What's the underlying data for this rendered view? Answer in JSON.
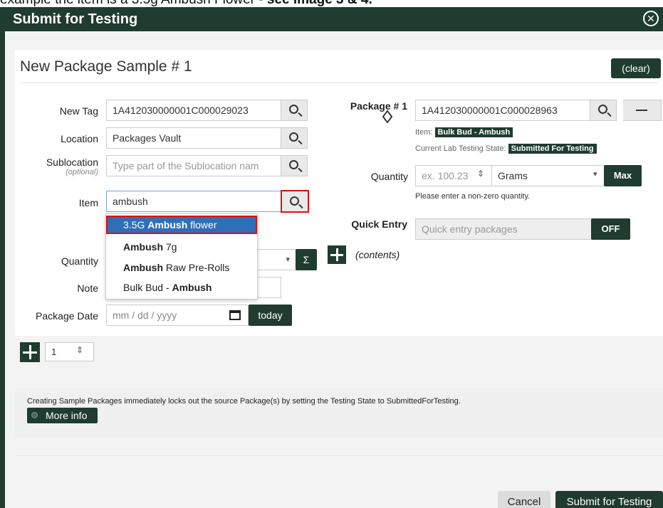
{
  "caption": {
    "pre": "example the item is a 3.5g Ambush Flower - ",
    "bold": "see image 3 & 4."
  },
  "modal": {
    "title": "Submit for Testing"
  },
  "sample": {
    "title": "New Package Sample # 1",
    "clear_label": "(clear)"
  },
  "left": {
    "new_tag": {
      "label": "New Tag",
      "value": "1A412030000001C000029023"
    },
    "location": {
      "label": "Location",
      "value": "Packages Vault"
    },
    "sublocation": {
      "label": "Sublocation",
      "hint": "(optional)",
      "placeholder": "Type part of the Sublocation nam"
    },
    "item": {
      "label": "Item",
      "value": "ambush"
    },
    "quantity": {
      "label": "Quantity",
      "sigma": "Σ"
    },
    "note": {
      "label": "Note"
    },
    "package_date": {
      "label": "Package Date",
      "placeholder": "mm / dd / yyyy",
      "today_label": "today"
    }
  },
  "dropdown": [
    {
      "pre": "3.5G ",
      "bold": "Ambush",
      "post": " flower",
      "active": true
    },
    {
      "pre": "",
      "bold": "Ambush",
      "post": " 7g",
      "active": false
    },
    {
      "pre": "",
      "bold": "Ambush",
      "post": " Raw Pre-Rolls",
      "active": false
    },
    {
      "pre": "Bulk Bud - ",
      "bold": "Ambush",
      "post": "",
      "active": false
    }
  ],
  "right": {
    "package_label": "Package # 1",
    "package_tag": "1A412030000001C000028963",
    "item_label": "Item:",
    "item_value": "Bulk Bud - Ambush",
    "state_label": "Current Lab Testing State:",
    "state_value": "Submitted For Testing",
    "quantity_label": "Quantity",
    "quantity_placeholder": "ex. 100.23",
    "unit": "Grams",
    "max_label": "Max",
    "quantity_hint": "Please enter a non-zero quantity.",
    "quick_entry_label": "Quick Entry",
    "quick_entry_placeholder": "Quick entry packages",
    "quick_entry_toggle": "OFF",
    "contents_label": "(contents)"
  },
  "counter": {
    "value": "1"
  },
  "info": {
    "text": "Creating Sample Packages immediately locks out the source Package(s) by setting the Testing State to SubmittedForTesting.",
    "more_info": "More info"
  },
  "footer": {
    "cancel": "Cancel",
    "submit": "Submit for Testing"
  }
}
